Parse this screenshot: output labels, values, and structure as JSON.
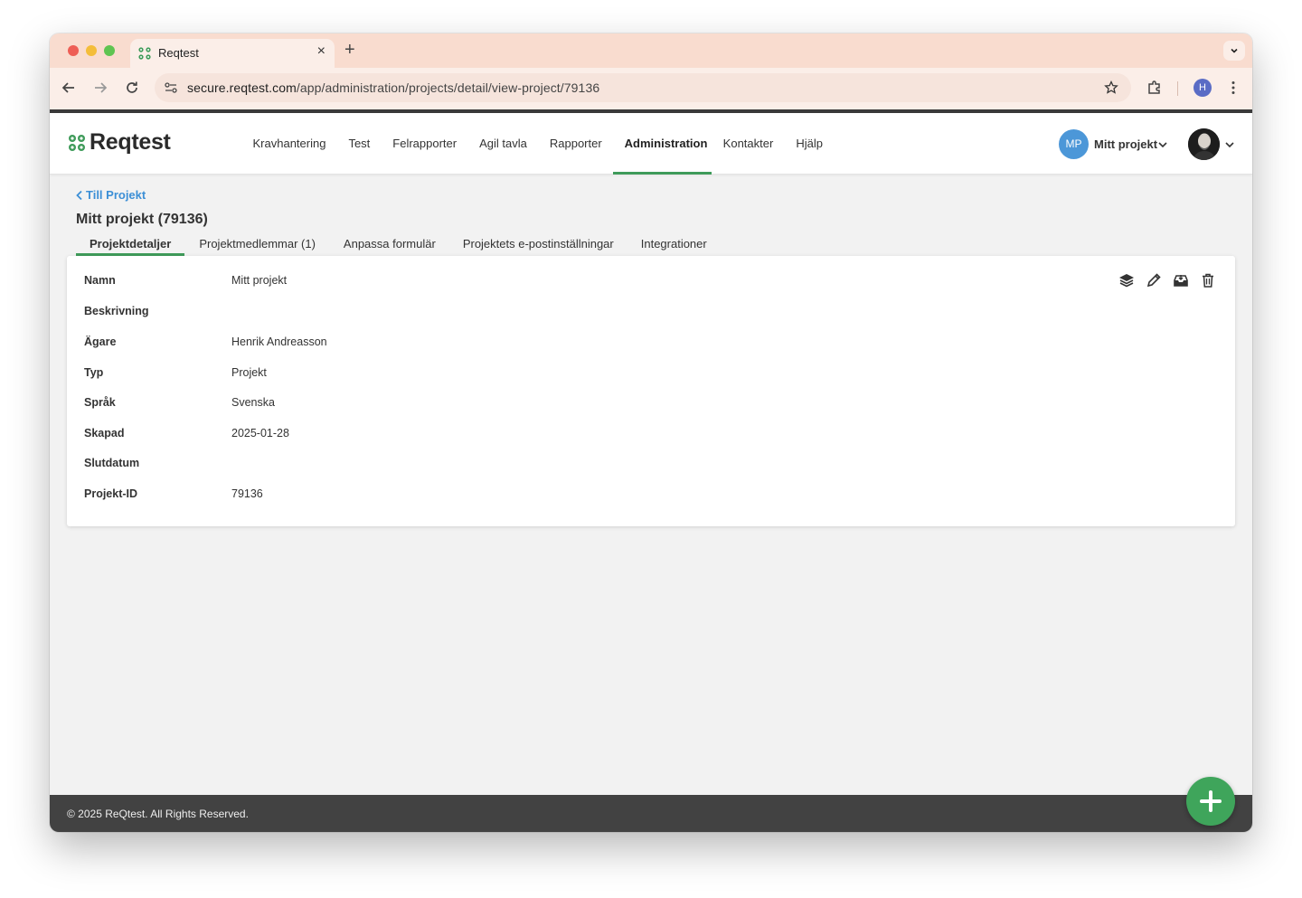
{
  "browser": {
    "tab_title": "Reqtest",
    "url_host": "secure.reqtest.com",
    "url_path": "/app/administration/projects/detail/view-project/79136",
    "profile_initial": "H"
  },
  "app": {
    "logo_text": "Reqtest",
    "nav": [
      {
        "label": "Kravhantering",
        "active": false
      },
      {
        "label": "Test",
        "active": false
      },
      {
        "label": "Felrapporter",
        "active": false
      },
      {
        "label": "Agil tavla",
        "active": false
      },
      {
        "label": "Rapporter",
        "active": false
      },
      {
        "label": "Administration",
        "active": true
      },
      {
        "label": "Kontakter",
        "active": false
      },
      {
        "label": "Hjälp",
        "active": false
      }
    ],
    "project_initials": "MP",
    "project_name": "Mitt projekt"
  },
  "page": {
    "back_label": "Till Projekt",
    "title": "Mitt projekt (79136)",
    "tabs": [
      {
        "label": "Projektdetaljer",
        "active": true
      },
      {
        "label": "Projektmedlemmar (1)",
        "active": false
      },
      {
        "label": "Anpassa formulär",
        "active": false
      },
      {
        "label": "Projektets e-postinställningar",
        "active": false
      },
      {
        "label": "Integrationer",
        "active": false
      }
    ],
    "fields": [
      {
        "label": "Namn",
        "value": "Mitt projekt"
      },
      {
        "label": "Beskrivning",
        "value": ""
      },
      {
        "label": "Ägare",
        "value": "Henrik Andreasson"
      },
      {
        "label": "Typ",
        "value": "Projekt"
      },
      {
        "label": "Språk",
        "value": "Svenska"
      },
      {
        "label": "Skapad",
        "value": "2025-01-28"
      },
      {
        "label": "Slutdatum",
        "value": ""
      },
      {
        "label": "Projekt-ID",
        "value": "79136"
      }
    ]
  },
  "footer": {
    "text": "© 2025 ReQtest. All Rights Reserved."
  },
  "colors": {
    "accent_green": "#3f9b5a",
    "link_blue": "#3c8fd6",
    "tabstrip": "#f9dccf"
  }
}
